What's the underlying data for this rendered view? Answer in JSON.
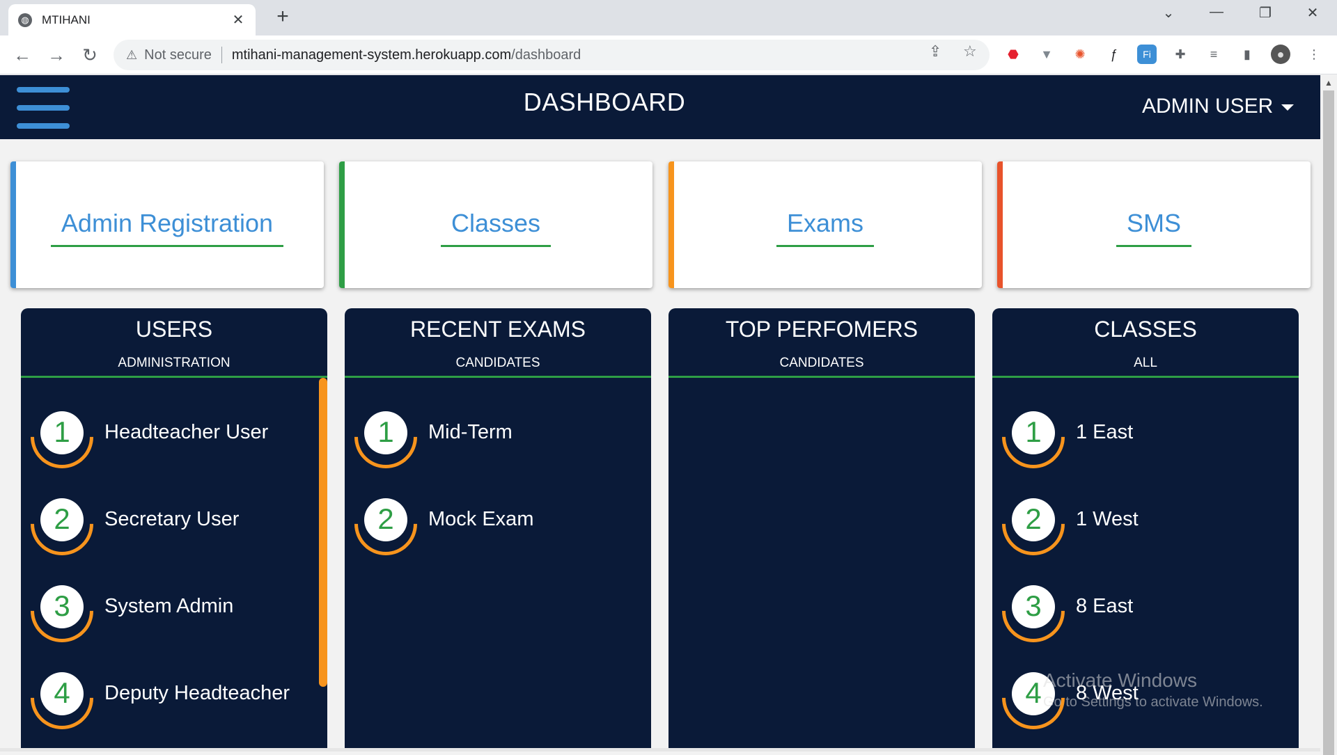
{
  "browser": {
    "tab_title": "MTIHANI",
    "tab_close": "✕",
    "new_tab": "+",
    "not_secure": "Not secure",
    "url_host": "mtihani-management-system.herokuapp.com",
    "url_path": "/dashboard"
  },
  "header": {
    "title": "DASHBOARD",
    "user": "ADMIN USER"
  },
  "nav_cards": [
    {
      "label": "Admin Registration",
      "accent": "#3d8fd6"
    },
    {
      "label": "Classes",
      "accent": "#2e9e45"
    },
    {
      "label": "Exams",
      "accent": "#f7941d"
    },
    {
      "label": "SMS",
      "accent": "#e8532b"
    }
  ],
  "panels": {
    "users": {
      "title": "USERS",
      "subtitle": "ADMINISTRATION",
      "items": [
        {
          "num": "1",
          "name": "Headteacher User"
        },
        {
          "num": "2",
          "name": "Secretary User"
        },
        {
          "num": "3",
          "name": "System Admin"
        },
        {
          "num": "4",
          "name": "Deputy Headteacher"
        }
      ]
    },
    "recent_exams": {
      "title": "RECENT EXAMS",
      "subtitle": "CANDIDATES",
      "items": [
        {
          "num": "1",
          "name": "Mid-Term"
        },
        {
          "num": "2",
          "name": "Mock Exam"
        }
      ]
    },
    "top_performers": {
      "title": "TOP PERFOMERS",
      "subtitle": "CANDIDATES",
      "items": []
    },
    "classes": {
      "title": "CLASSES",
      "subtitle": "ALL",
      "items": [
        {
          "num": "1",
          "name": "1 East"
        },
        {
          "num": "2",
          "name": "1 West"
        },
        {
          "num": "3",
          "name": "8 East"
        },
        {
          "num": "4",
          "name": "8 West"
        }
      ]
    }
  },
  "watermark": {
    "line1": "Activate Windows",
    "line2": "Go to Settings to activate Windows."
  },
  "colors": {
    "header_bg": "#0a1a38",
    "accent_blue": "#3d8fd6",
    "accent_green": "#2e9e45",
    "accent_orange": "#f7941d",
    "accent_red": "#e8532b"
  }
}
